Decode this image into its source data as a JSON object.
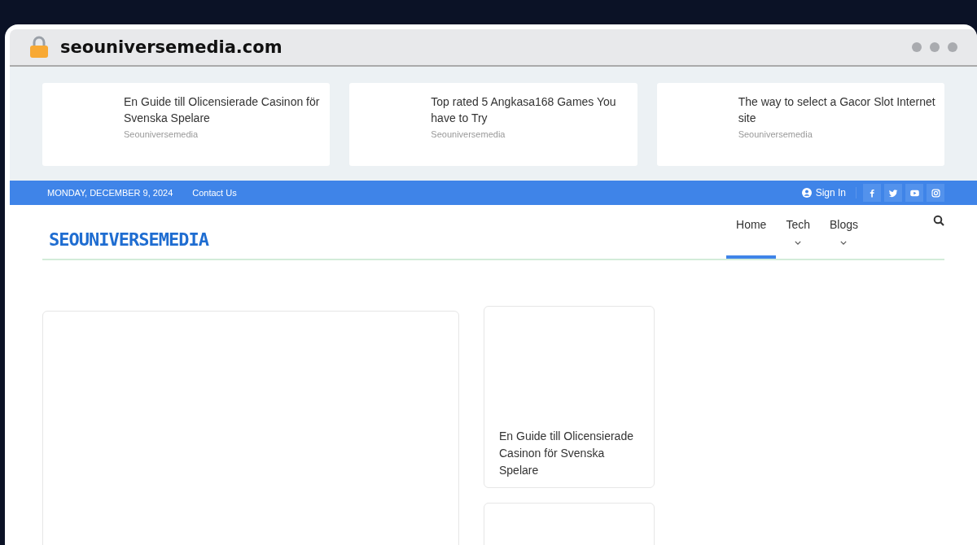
{
  "browser": {
    "url": "seouniversemedia.com"
  },
  "ticker": [
    {
      "title": "En Guide till Olicensierade Casinon för Svenska Spelare",
      "source": "Seouniversemedia"
    },
    {
      "title": "Top rated 5 Angkasa168 Games You have to Try",
      "source": "Seouniversemedia"
    },
    {
      "title": "The way to select a Gacor Slot Internet site",
      "source": "Seouniversemedia"
    }
  ],
  "topbar": {
    "date": "MONDAY, DECEMBER 9, 2024",
    "links": [
      "Contact Us"
    ],
    "signin": "Sign In",
    "social": [
      {
        "kind": "facebook"
      },
      {
        "kind": "twitter"
      },
      {
        "kind": "youtube"
      },
      {
        "kind": "instagram"
      }
    ]
  },
  "header": {
    "logo": "SEOUNIVERSEMEDIA",
    "nav": [
      {
        "label": "Home",
        "selected": true,
        "dropdown": false
      },
      {
        "label": "Tech",
        "selected": false,
        "dropdown": true
      },
      {
        "label": "Blogs",
        "selected": false,
        "dropdown": true
      }
    ]
  },
  "side_posts": [
    {
      "title": "En Guide till Olicensierade Casinon för Svenska Spelare"
    }
  ]
}
